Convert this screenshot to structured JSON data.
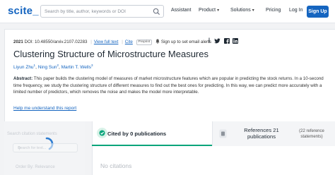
{
  "header": {
    "logo": "scite_",
    "search_placeholder": "Search by title, author, keywords or DOI",
    "nav": {
      "assistant": "Assistant",
      "product": "Product",
      "solutions": "Solutions",
      "pricing": "Pricing",
      "login": "Log In",
      "signup": "Sign Up"
    }
  },
  "paper": {
    "year": "2021",
    "doi": "DOI: 10.48550/arxiv.2107.02283",
    "view_full_text": "View full text",
    "cite": "Cite",
    "badge": "Preprint",
    "alert": "Sign up to set email alerts",
    "title": "Clustering Structure of Microstructure Measures",
    "authors": [
      {
        "name": "Liyun Zhu",
        "sup": "1"
      },
      {
        "name": "Ning Sun",
        "sup": "2"
      },
      {
        "name": "Martin T. Wells",
        "sup": "3"
      }
    ],
    "abstract_label": "Abstract:",
    "abstract_text": "This paper builds the clustering model of measures of market microstructure features which are popular in predicting the stock returns. In a 10-second time frequency, we study the clustering structure of different measures to find out the best ones for predicting. In this way, we can predict more accurately with a limited number of predictors, which removes the noise and makes the model more interpretable.",
    "help_link": "Help me understand this report"
  },
  "sidebar": {
    "search_label": "Search citation statements",
    "search_placeholder": "Search for text...",
    "order_label": "Order By: Relevance"
  },
  "tabs": {
    "cited": "Cited by 0 publications",
    "references": "References 21 publications",
    "ref_statements": "(22 reference statements)"
  },
  "main": {
    "empty_text": "No citations"
  },
  "colors": {
    "brand": "#1565c0",
    "accent_green": "#0aa57b"
  }
}
